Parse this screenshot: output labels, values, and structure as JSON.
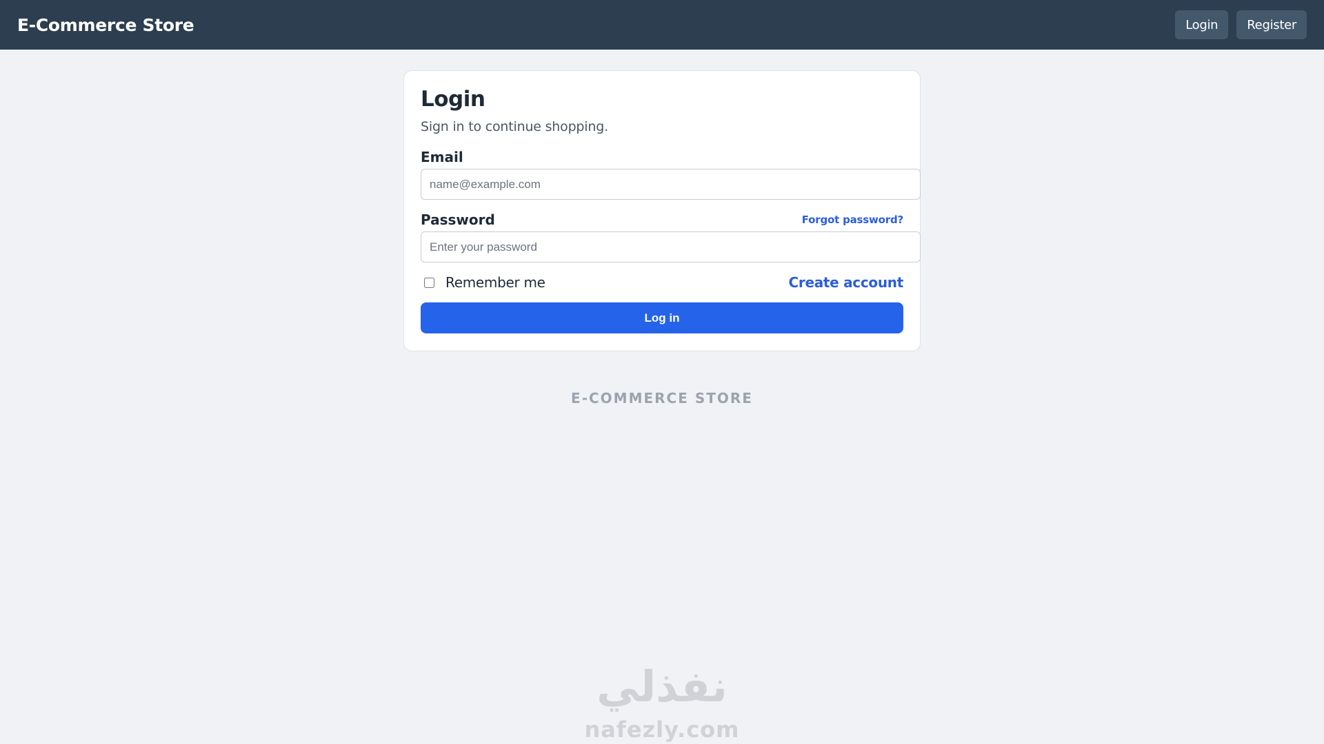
{
  "header": {
    "brand": "E-Commerce Store",
    "nav": [
      {
        "label": "Login"
      },
      {
        "label": "Register"
      }
    ]
  },
  "login_card": {
    "title": "Login",
    "subtitle": "Sign in to continue shopping.",
    "email": {
      "label": "Email",
      "value": "",
      "placeholder": "name@example.com"
    },
    "password": {
      "label": "Password",
      "value": "",
      "placeholder": "Enter your password",
      "forgot_link": "Forgot password?"
    },
    "remember": {
      "label": "Remember me",
      "checked": false
    },
    "create_account_link": "Create account",
    "submit_label": "Log in"
  },
  "footer": {
    "brand": "E-COMMERCE STORE"
  },
  "watermark": {
    "arabic_text": "نفذلي",
    "latin_text": "nafezly.com"
  },
  "colors": {
    "header_bg": "#2c3e50",
    "page_bg": "#f0f2f5",
    "primary": "#2563eb",
    "link": "#2b5ed8"
  }
}
